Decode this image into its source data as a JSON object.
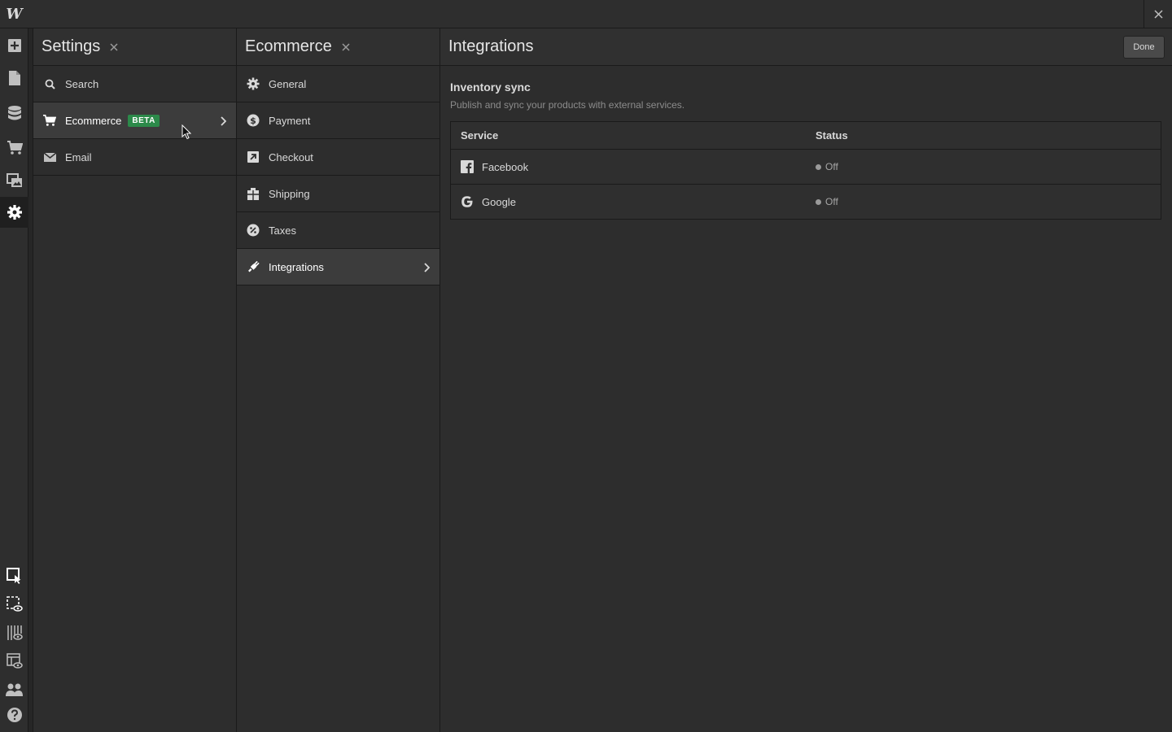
{
  "app": {
    "logo_letter": "W"
  },
  "colors": {
    "badge": "#2c8a4a",
    "background": "#2b2b2b"
  },
  "left_toolbar": {
    "top_icons": [
      "add-icon",
      "pages-icon",
      "cms-icon",
      "ecommerce-icon",
      "assets-icon",
      "settings-icon"
    ],
    "bottom_icons": [
      "select-icon",
      "preview-box-icon",
      "grid-preview-icon",
      "layout-preview-icon",
      "users-icon",
      "help-icon"
    ]
  },
  "settings": {
    "title": "Settings",
    "items": [
      {
        "label": "Search",
        "icon": "search-icon"
      },
      {
        "label": "Ecommerce",
        "icon": "cart-icon",
        "badge": "BETA"
      },
      {
        "label": "Email",
        "icon": "mail-icon"
      }
    ]
  },
  "ecommerce": {
    "title": "Ecommerce",
    "items": [
      {
        "label": "General",
        "icon": "gear-icon"
      },
      {
        "label": "Payment",
        "icon": "dollar-icon"
      },
      {
        "label": "Checkout",
        "icon": "checkout-icon"
      },
      {
        "label": "Shipping",
        "icon": "shipping-icon"
      },
      {
        "label": "Taxes",
        "icon": "taxes-icon"
      },
      {
        "label": "Integrations",
        "icon": "plug-icon"
      }
    ]
  },
  "integrations": {
    "title": "Integrations",
    "done_label": "Done",
    "section_title": "Inventory sync",
    "section_desc": "Publish and sync your products with external services.",
    "table": {
      "headers": [
        "Service",
        "Status"
      ],
      "rows": [
        {
          "service": "Facebook",
          "icon": "facebook-icon",
          "status": "Off"
        },
        {
          "service": "Google",
          "icon": "google-icon",
          "status": "Off"
        }
      ]
    }
  }
}
